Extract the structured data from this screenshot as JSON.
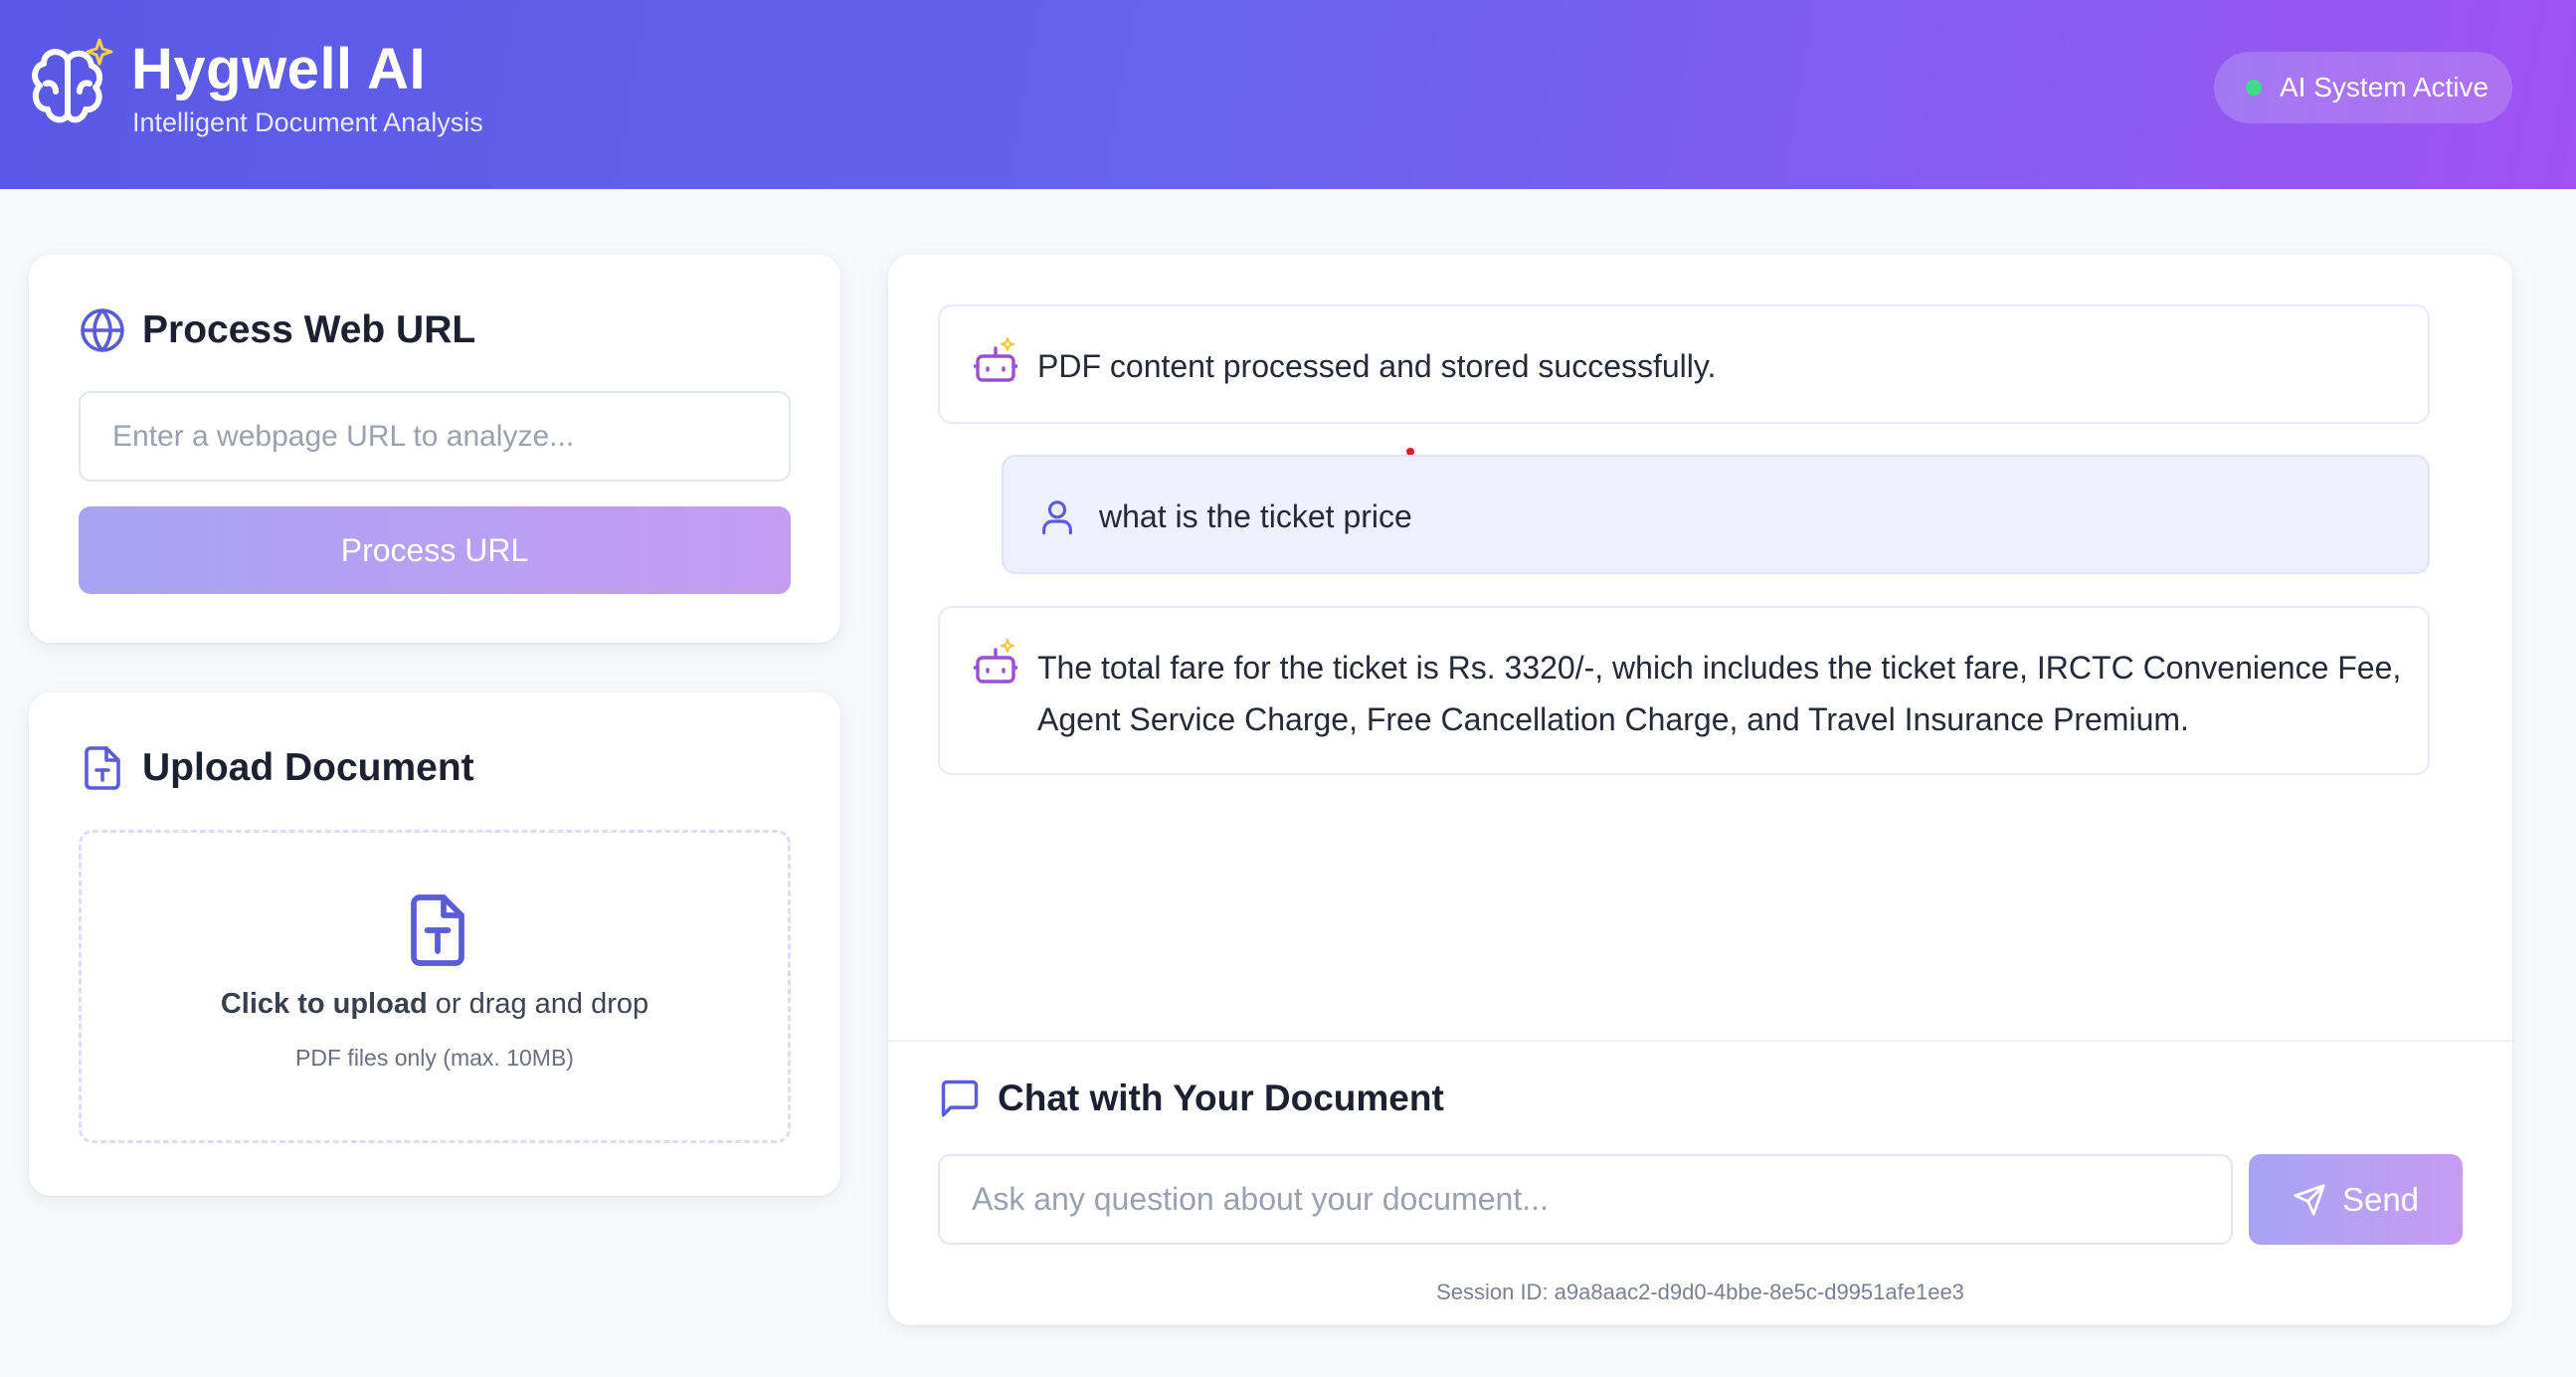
{
  "header": {
    "title": "Hygwell AI",
    "subtitle": "Intelligent Document Analysis",
    "status": "AI System Active",
    "logo_icon": "brain-sparkle-icon"
  },
  "colors": {
    "header_start": "#5a58e6",
    "header_end": "#a052f2",
    "accent": "#6366f1",
    "status_dot": "#3fdc86",
    "button_start": "#a7a3f3",
    "button_end": "#c69cf1"
  },
  "url_panel": {
    "title": "Process Web URL",
    "input_placeholder": "Enter a webpage URL to analyze...",
    "button_label": "Process URL",
    "icon": "globe-icon"
  },
  "upload_panel": {
    "title": "Upload Document",
    "click_text": "Click to upload",
    "drag_text": " or drag and drop",
    "hint": "PDF files only (max. 10MB)",
    "icon": "file-type-icon"
  },
  "messages": [
    {
      "role": "bot",
      "text": "PDF content processed and stored successfully."
    },
    {
      "role": "user",
      "text": "what is the ticket price"
    },
    {
      "role": "bot",
      "text": "The total fare for the ticket is Rs. 3320/-, which includes the ticket fare, IRCTC Convenience Fee, Agent Service Charge, Free Cancellation Charge, and Travel Insurance Premium."
    }
  ],
  "chat": {
    "title": "Chat with Your Document",
    "input_placeholder": "Ask any question about your document...",
    "send_label": "Send",
    "session_id": "Session ID: a9a8aac2-d9d0-4bbe-8e5c-d9951afe1ee3"
  }
}
